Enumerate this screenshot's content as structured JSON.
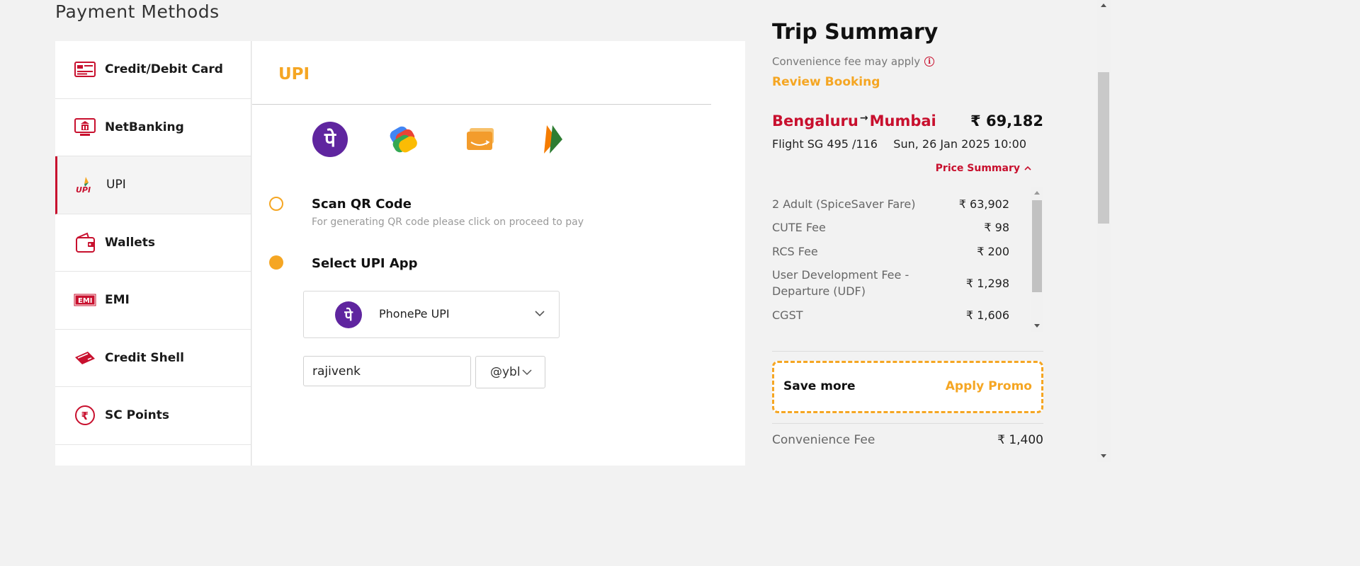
{
  "page_title": "Payment Methods",
  "methods": [
    {
      "label": "Credit/Debit Card",
      "icon": "credit-card-icon"
    },
    {
      "label": "NetBanking",
      "icon": "netbanking-icon"
    },
    {
      "label": "UPI",
      "icon": "upi-icon",
      "active": true
    },
    {
      "label": "Wallets",
      "icon": "wallet-icon"
    },
    {
      "label": "EMI",
      "icon": "emi-icon"
    },
    {
      "label": "Credit Shell",
      "icon": "credit-shell-icon"
    },
    {
      "label": "SC Points",
      "icon": "rupee-coin-icon"
    }
  ],
  "upi": {
    "title": "UPI",
    "apps": [
      "phonepe-icon",
      "google-pay-icon",
      "amazon-pay-icon",
      "bhim-icon"
    ],
    "phonepe_glyph": "पे",
    "scan_title": "Scan QR Code",
    "scan_subtitle": "For generating QR code please click on proceed to pay",
    "select_title": "Select UPI App",
    "selected_app": "PhonePe UPI",
    "upi_id_value": "rajivenk",
    "handle": "@ybl"
  },
  "summary": {
    "title": "Trip Summary",
    "convenience_note": "Convenience fee may apply",
    "review_link": "Review Booking",
    "from": "Bengaluru",
    "to": "Mumbai",
    "arrow": "→",
    "total": "₹ 69,182",
    "flight": "Flight  SG 495 /116",
    "date": "Sun, 26 Jan 2025 10:00",
    "price_summary": "Price Summary",
    "fees": [
      {
        "name": "2 Adult  (SpiceSaver Fare)",
        "value": "₹ 63,902"
      },
      {
        "name": "CUTE Fee",
        "value": "₹ 98"
      },
      {
        "name": "RCS Fee",
        "value": "₹ 200"
      },
      {
        "name": "User Development Fee - Departure (UDF)",
        "value": "₹ 1,298"
      },
      {
        "name": "CGST",
        "value": "₹ 1,606"
      }
    ],
    "promo_left": "Save more",
    "promo_right": "Apply Promo",
    "convenience_fee_label": "Convenience Fee",
    "convenience_fee_value": "₹ 1,400"
  },
  "colors": {
    "brand_red": "#c8102e",
    "accent_orange": "#f5a623",
    "phonepe_purple": "#5f259f"
  }
}
